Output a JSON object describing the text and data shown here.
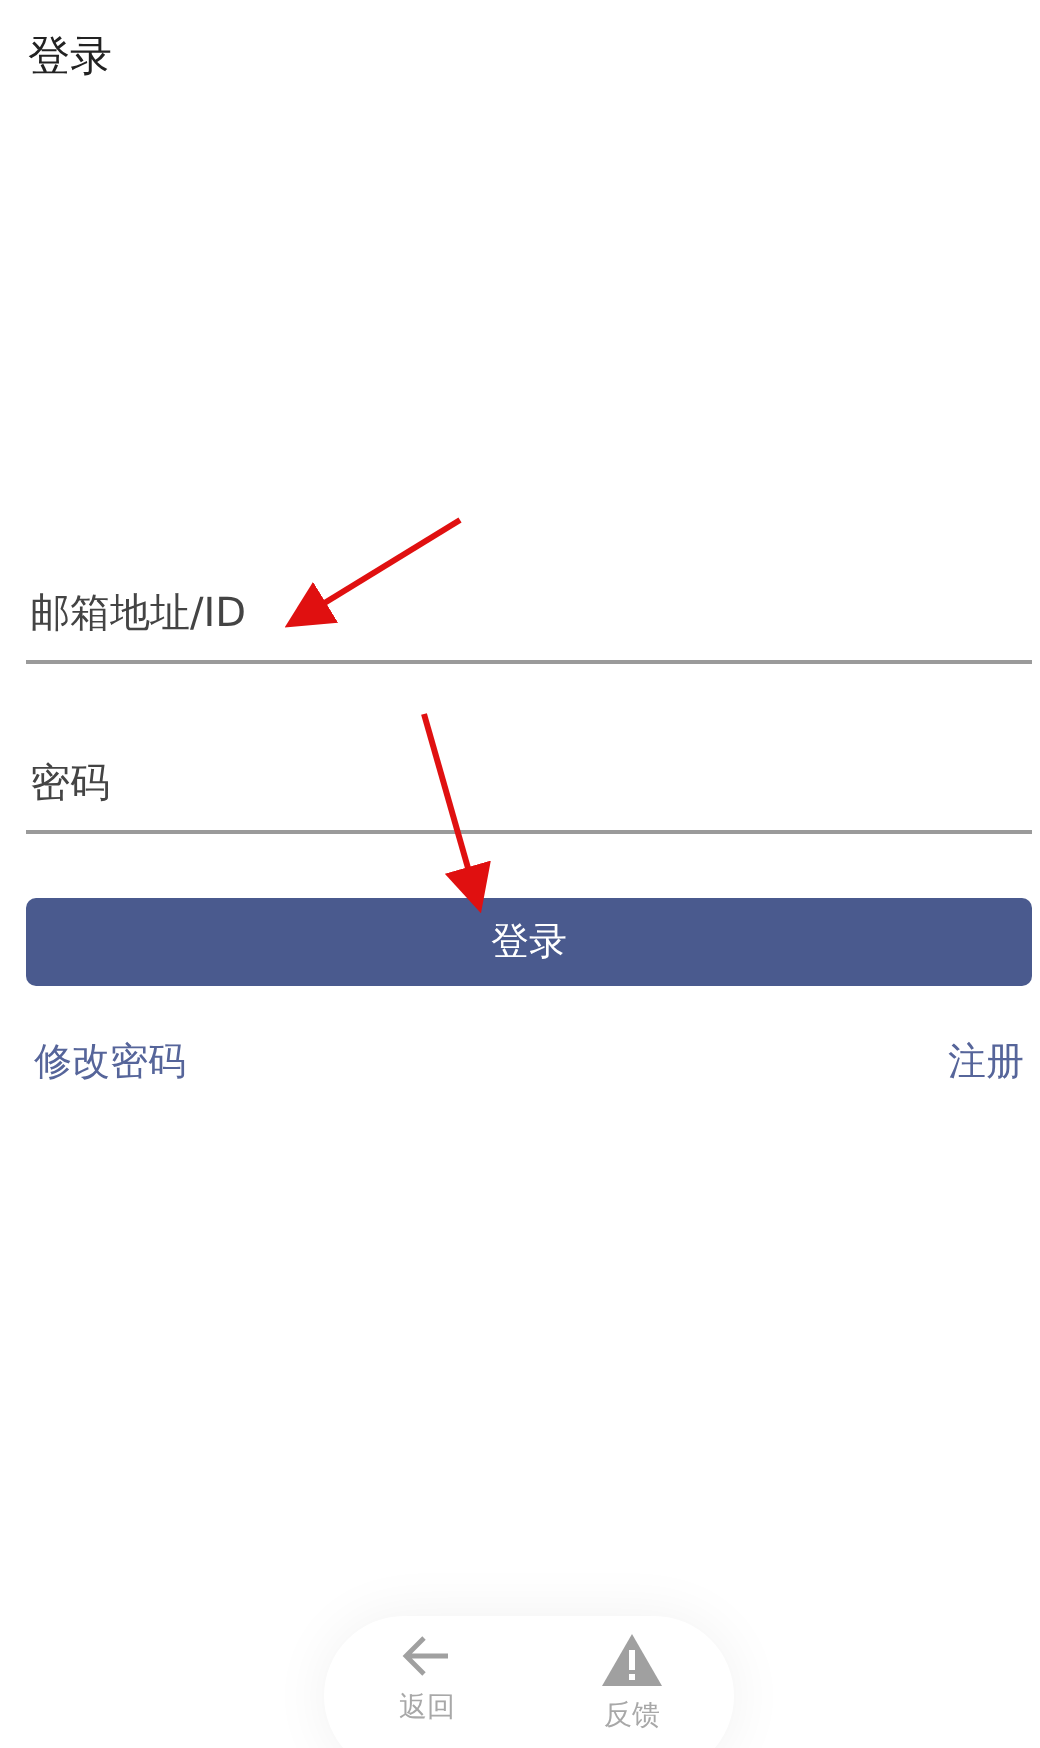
{
  "title": "登录",
  "fields": [
    {
      "placeholder": "邮箱地址/ID"
    },
    {
      "placeholder": "密码"
    }
  ],
  "submit": "登录",
  "links": [
    "修改密码",
    "注册"
  ],
  "bottom_bar": [
    {
      "kind": "back",
      "label": "返回"
    },
    {
      "kind": "warning",
      "label": "反馈"
    }
  ]
}
